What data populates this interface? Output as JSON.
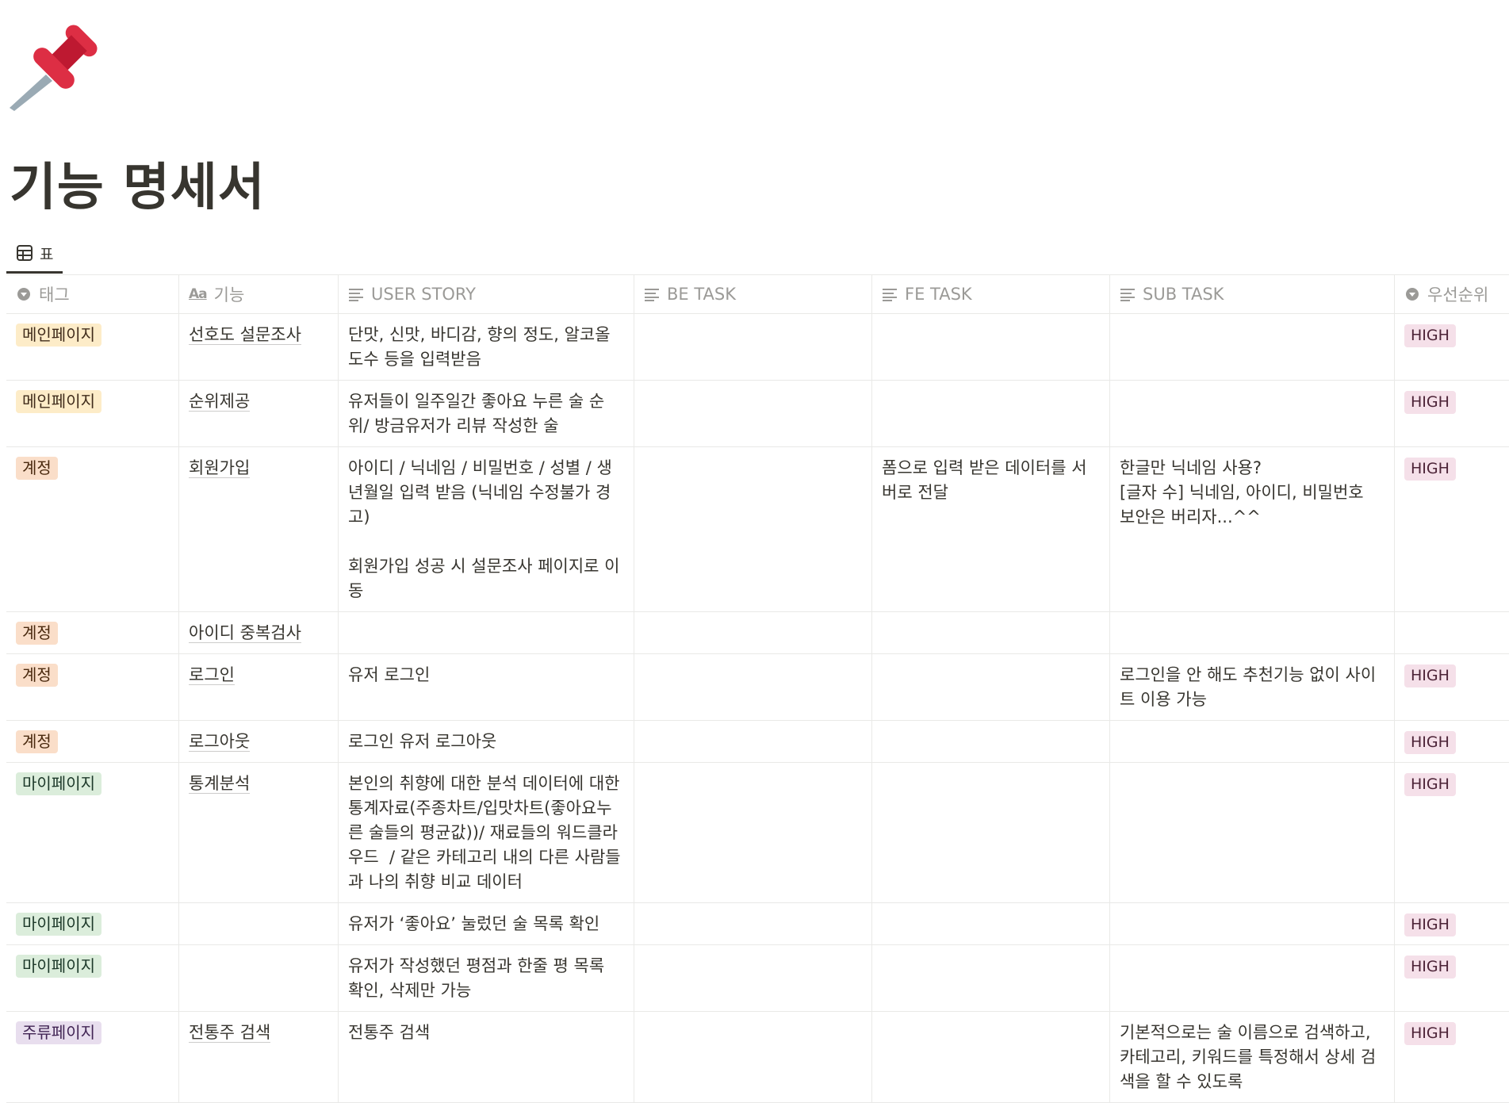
{
  "page": {
    "icon": "pushpin-icon",
    "title": "기능 명세서"
  },
  "view_tab": {
    "icon": "table-icon",
    "label": "표"
  },
  "colors": {
    "tag_main": "#fdecc8",
    "tag_account": "#fadec9",
    "tag_mypage": "#dbeddb",
    "tag_liquor": "#e8deee",
    "priority_high": "#f5e0e9",
    "header_text": "#9b9a97"
  },
  "table": {
    "columns": [
      {
        "label": "태그",
        "icon": "select-icon"
      },
      {
        "label": "기능",
        "icon": "title-aa-icon"
      },
      {
        "label": "USER STORY",
        "icon": "text-lines-icon"
      },
      {
        "label": "BE TASK",
        "icon": "text-lines-icon"
      },
      {
        "label": "FE TASK",
        "icon": "text-lines-icon"
      },
      {
        "label": "SUB TASK",
        "icon": "text-lines-icon"
      },
      {
        "label": "우선순위",
        "icon": "select-icon"
      }
    ],
    "rows": [
      {
        "tag": "메인페이지",
        "tag_type": "main",
        "feature": "선호도 설문조사",
        "user_story": "단맛, 신맛, 바디감, 향의 정도, 알코올 도수 등을 입력받음",
        "be_task": "",
        "fe_task": "",
        "sub_task": "",
        "priority": "HIGH"
      },
      {
        "tag": "메인페이지",
        "tag_type": "main",
        "feature": "순위제공",
        "user_story": "유저들이 일주일간 좋아요 누른 술 순위/ 방금유저가 리뷰 작성한 술",
        "be_task": "",
        "fe_task": "",
        "sub_task": "",
        "priority": "HIGH"
      },
      {
        "tag": "계정",
        "tag_type": "account",
        "feature": "회원가입",
        "user_story": "아이디 / 닉네임 / 비밀번호 / 성별 / 생년월일 입력 받음 (닉네임 수정불가 경고)\n\n회원가입 성공 시 설문조사 페이지로 이동",
        "be_task": "",
        "fe_task": "폼으로 입력 받은 데이터를 서버로 전달",
        "sub_task": "한글만 닉네임 사용?\n[글자 수] 닉네임, 아이디, 비밀번호\n보안은 버리자...^^",
        "priority": "HIGH"
      },
      {
        "tag": "계정",
        "tag_type": "account",
        "feature": "아이디 중복검사",
        "user_story": "",
        "be_task": "",
        "fe_task": "",
        "sub_task": "",
        "priority": ""
      },
      {
        "tag": "계정",
        "tag_type": "account",
        "feature": "로그인",
        "user_story": "유저 로그인",
        "be_task": "",
        "fe_task": "",
        "sub_task": "로그인을 안 해도 추천기능 없이 사이트 이용 가능",
        "priority": "HIGH"
      },
      {
        "tag": "계정",
        "tag_type": "account",
        "feature": "로그아웃",
        "user_story": "로그인 유저 로그아웃",
        "be_task": "",
        "fe_task": "",
        "sub_task": "",
        "priority": "HIGH"
      },
      {
        "tag": "마이페이지",
        "tag_type": "mypage",
        "feature": "통계분석",
        "user_story": "본인의 취향에 대한 분석 데이터에 대한 통계자료(주종차트/입맛차트(좋아요누른 술들의 평균값))/ 재료들의 워드클라우드  / 같은 카테고리 내의 다른 사람들과 나의 취향 비교 데이터",
        "be_task": "",
        "fe_task": "",
        "sub_task": "",
        "priority": "HIGH"
      },
      {
        "tag": "마이페이지",
        "tag_type": "mypage",
        "feature": "",
        "user_story": "유저가 ‘좋아요’ 눌렀던 술 목록 확인",
        "be_task": "",
        "fe_task": "",
        "sub_task": "",
        "priority": "HIGH"
      },
      {
        "tag": "마이페이지",
        "tag_type": "mypage",
        "feature": "",
        "user_story": "유저가 작성했던 평점과 한줄 평 목록 확인, 삭제만 가능",
        "be_task": "",
        "fe_task": "",
        "sub_task": "",
        "priority": "HIGH"
      },
      {
        "tag": "주류페이지",
        "tag_type": "liquor",
        "feature": "전통주 검색",
        "user_story": "전통주 검색",
        "be_task": "",
        "fe_task": "",
        "sub_task": "기본적으로는 술 이름으로 검색하고, 카테고리, 키워드를 특정해서 상세 검색을 할 수 있도록",
        "priority": "HIGH"
      }
    ]
  }
}
